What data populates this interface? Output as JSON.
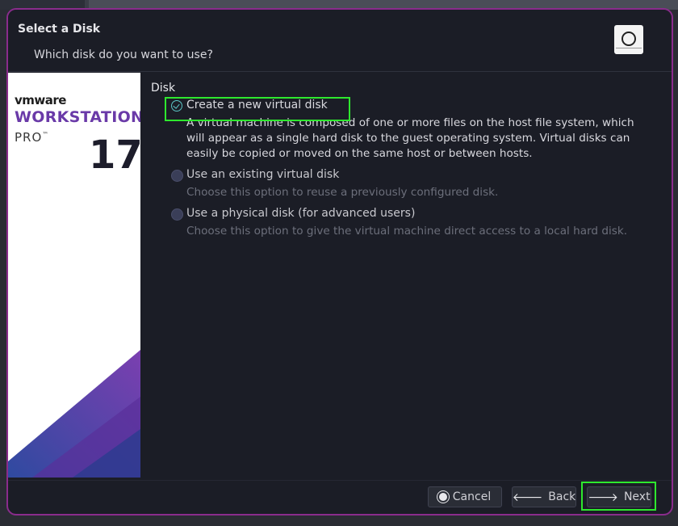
{
  "dialog": {
    "title": "Select a Disk",
    "subtitle": "Which disk do you want to use?",
    "header_icon": "disk-icon"
  },
  "sidebar": {
    "brand_vm": "vmware",
    "brand_product": "WORKSTATION",
    "brand_edition": "PRO",
    "brand_tm": "™",
    "brand_version": "17",
    "colors": {
      "product": "#6a3aa8",
      "deco_purple": "#7b3fb0",
      "deco_blue": "#2f4aa0"
    }
  },
  "disk_section": {
    "label": "Disk",
    "options": [
      {
        "label": "Create a new virtual disk",
        "description": "A virtual machine is composed of one or more files on the host file system, which will appear as a single hard disk to the guest operating system. Virtual disks can easily be copied or moved on the same host or between hosts.",
        "selected": true,
        "enabled": true
      },
      {
        "label": "Use an existing virtual disk",
        "description": "Choose this option to reuse a previously configured disk.",
        "selected": false,
        "enabled": true
      },
      {
        "label": "Use a physical disk (for advanced users)",
        "description": "Choose this option to give the virtual machine direct access to a local hard disk.",
        "selected": false,
        "enabled": true
      }
    ]
  },
  "footer": {
    "cancel_label": "Cancel",
    "back_label": "Back",
    "next_label": "Next",
    "cancel_icon": "cancel-icon",
    "back_icon": "arrow-left-icon",
    "next_icon": "arrow-right-icon"
  },
  "highlight_color": "#2ee82e",
  "border_color": "#8a2c8c"
}
